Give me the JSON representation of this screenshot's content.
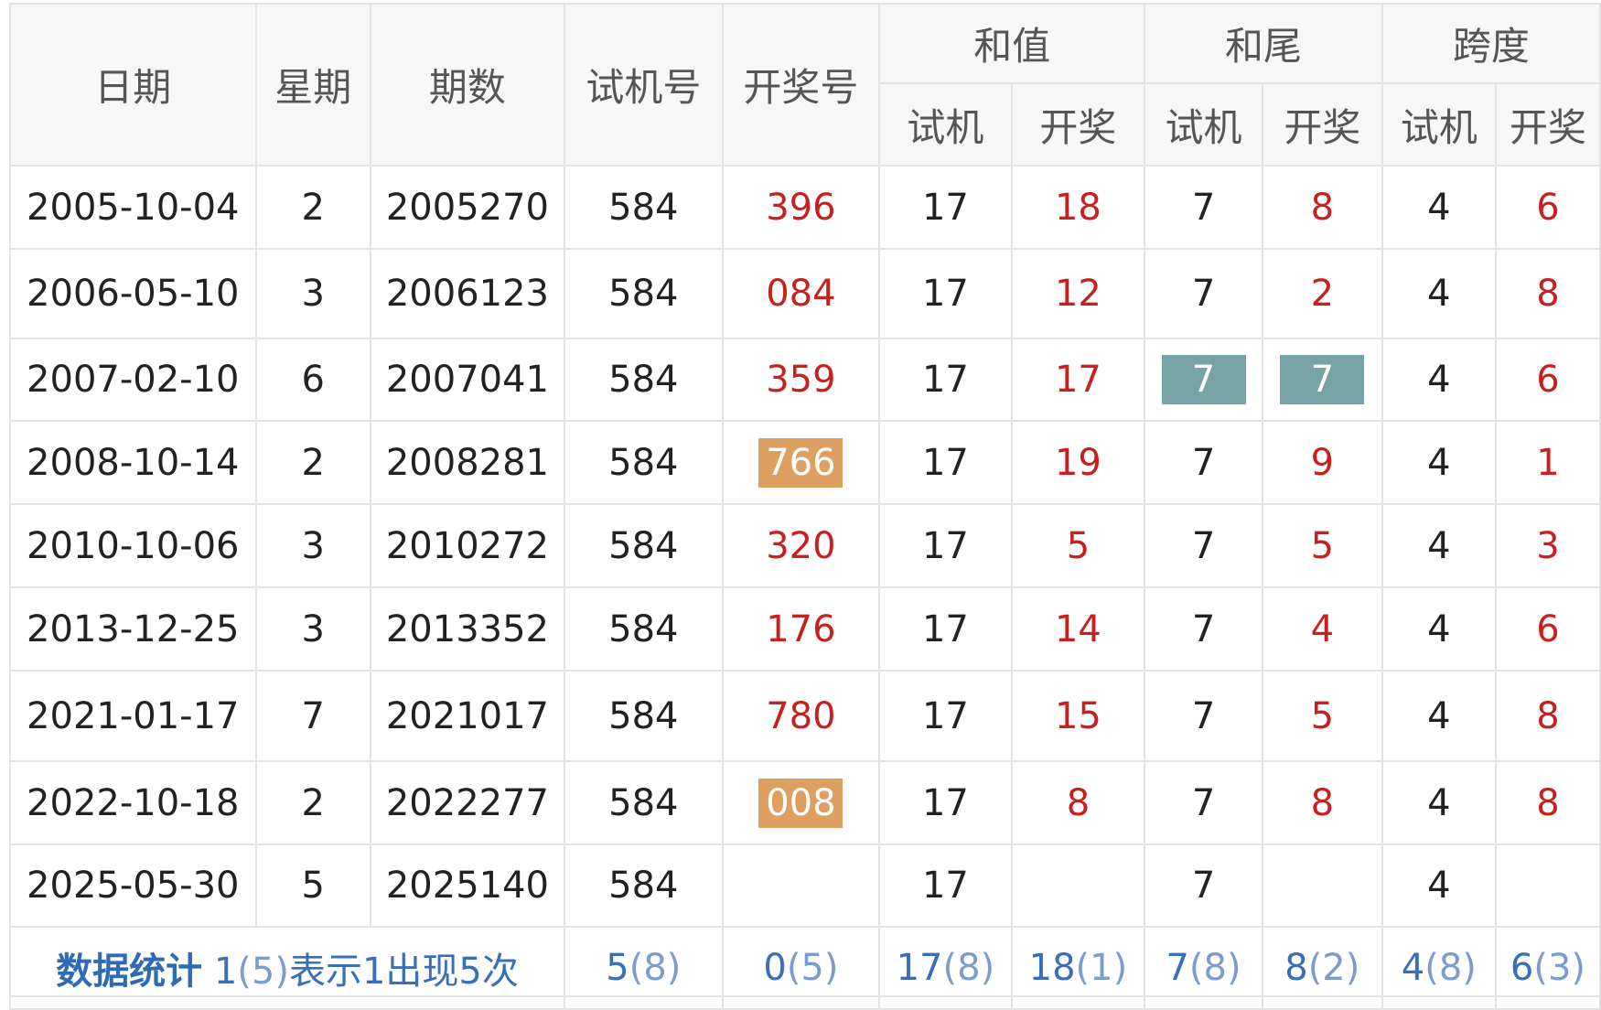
{
  "headers": {
    "date": "日期",
    "weekday": "星期",
    "issue": "期数",
    "trial": "试机号",
    "draw": "开奖号",
    "sum_group": "和值",
    "tail_group": "和尾",
    "span_group": "跨度",
    "sub_trial": "试机",
    "sub_draw": "开奖"
  },
  "rows": [
    {
      "date": "2005-10-04",
      "weekday": "2",
      "issue": "2005270",
      "trial": "584",
      "draw": "396",
      "sum_trial": "17",
      "sum_draw": "18",
      "tail_trial": "7",
      "tail_draw": "8",
      "span_trial": "4",
      "span_draw": "6"
    },
    {
      "date": "2006-05-10",
      "weekday": "3",
      "issue": "2006123",
      "trial": "584",
      "draw": "084",
      "sum_trial": "17",
      "sum_draw": "12",
      "tail_trial": "7",
      "tail_draw": "2",
      "span_trial": "4",
      "span_draw": "8"
    },
    {
      "date": "2007-02-10",
      "weekday": "6",
      "issue": "2007041",
      "trial": "584",
      "draw": "359",
      "sum_trial": "17",
      "sum_draw": "17",
      "tail_trial": "7",
      "tail_draw": "7",
      "span_trial": "4",
      "span_draw": "6"
    },
    {
      "date": "2008-10-14",
      "weekday": "2",
      "issue": "2008281",
      "trial": "584",
      "draw": "766",
      "sum_trial": "17",
      "sum_draw": "19",
      "tail_trial": "7",
      "tail_draw": "9",
      "span_trial": "4",
      "span_draw": "1"
    },
    {
      "date": "2010-10-06",
      "weekday": "3",
      "issue": "2010272",
      "trial": "584",
      "draw": "320",
      "sum_trial": "17",
      "sum_draw": "5",
      "tail_trial": "7",
      "tail_draw": "5",
      "span_trial": "4",
      "span_draw": "3"
    },
    {
      "date": "2013-12-25",
      "weekday": "3",
      "issue": "2013352",
      "trial": "584",
      "draw": "176",
      "sum_trial": "17",
      "sum_draw": "14",
      "tail_trial": "7",
      "tail_draw": "4",
      "span_trial": "4",
      "span_draw": "6"
    },
    {
      "date": "2021-01-17",
      "weekday": "7",
      "issue": "2021017",
      "trial": "584",
      "draw": "780",
      "sum_trial": "17",
      "sum_draw": "15",
      "tail_trial": "7",
      "tail_draw": "5",
      "span_trial": "4",
      "span_draw": "8"
    },
    {
      "date": "2022-10-18",
      "weekday": "2",
      "issue": "2022277",
      "trial": "584",
      "draw": "008",
      "sum_trial": "17",
      "sum_draw": "8",
      "tail_trial": "7",
      "tail_draw": "8",
      "span_trial": "4",
      "span_draw": "8"
    },
    {
      "date": "2025-05-30",
      "weekday": "5",
      "issue": "2025140",
      "trial": "584",
      "draw": "",
      "sum_trial": "17",
      "sum_draw": "",
      "tail_trial": "7",
      "tail_draw": "",
      "span_trial": "4",
      "span_draw": ""
    }
  ],
  "stats": {
    "title": "数据统计",
    "note_value": "1",
    "note_paren": "(5)",
    "note_text": "表示1出现5次",
    "trial": {
      "value": "5",
      "count": "(8)"
    },
    "draw": {
      "value": "0",
      "count": "(5)"
    },
    "sum_trial": {
      "value": "17",
      "count": "(8)"
    },
    "sum_draw": {
      "value": "18",
      "count": "(1)"
    },
    "tail_trial": {
      "value": "7",
      "count": "(8)"
    },
    "tail_draw": {
      "value": "8",
      "count": "(2)"
    },
    "span_trial": {
      "value": "4",
      "count": "(8)"
    },
    "span_draw": {
      "value": "6",
      "count": "(3)"
    }
  },
  "colors": {
    "draw_text": "#c81f1f",
    "highlight_orange": "#dea060",
    "highlight_teal": "#78a3a6",
    "stats_blue": "#3a6fb8",
    "border": "#e3e3e3",
    "header_bg": "#f7f7f7"
  }
}
